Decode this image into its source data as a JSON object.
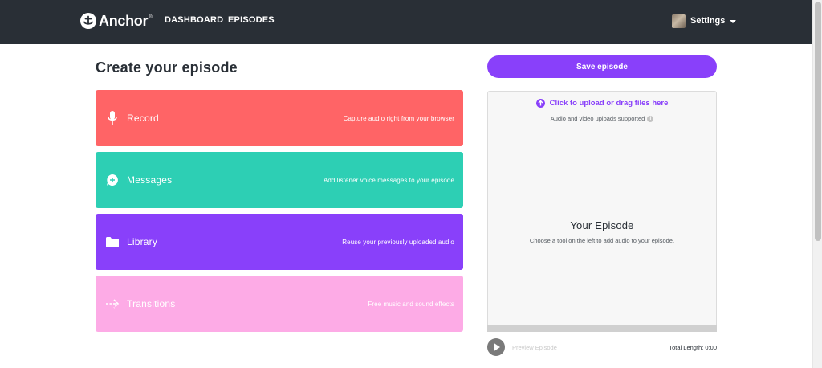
{
  "header": {
    "logo_text": "Anchor",
    "logo_reg": "®",
    "nav": [
      {
        "label": "DASHBOARD"
      },
      {
        "label": "EPISODES"
      }
    ],
    "settings_label": "Settings"
  },
  "main": {
    "title": "Create your episode",
    "tools": [
      {
        "name": "Record",
        "description": "Capture audio right from your browser",
        "icon": "microphone-icon",
        "color": "#ff6466"
      },
      {
        "name": "Messages",
        "description": "Add listener voice messages to your episode",
        "icon": "message-add-icon",
        "color": "#2dcfb4"
      },
      {
        "name": "Library",
        "description": "Reuse your previously uploaded audio",
        "icon": "folder-icon",
        "color": "#8940fa"
      },
      {
        "name": "Transitions",
        "description": "Free music and sound effects",
        "icon": "arrow-right-icon",
        "color": "#fdabe6"
      }
    ]
  },
  "episode": {
    "save_label": "Save episode",
    "upload_label": "Click to upload or drag files here",
    "upload_sub": "Audio and video uploads supported",
    "title": "Your Episode",
    "hint": "Choose a tool on the left to add audio to your episode.",
    "preview_label": "Preview Episode",
    "total_length": "Total Length: 0:00"
  },
  "colors": {
    "header_bg": "#292f36",
    "accent": "#8940fa"
  }
}
